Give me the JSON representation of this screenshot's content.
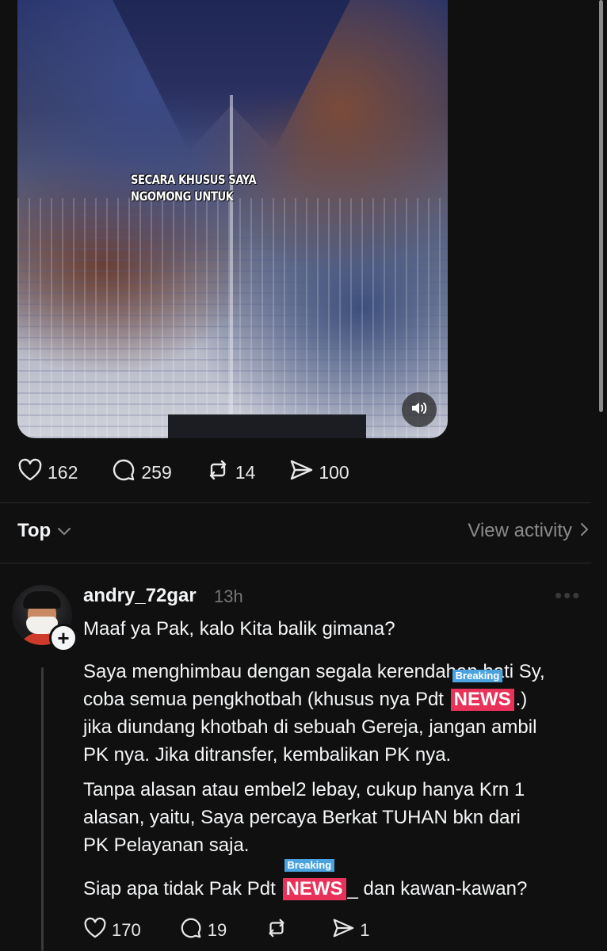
{
  "video": {
    "caption": "SECARA KHUSUS SAYA NGOMONG UNTUK",
    "sound_icon": "speaker-icon"
  },
  "post_actions": {
    "likes": "162",
    "replies": "259",
    "reposts": "14",
    "shares": "100"
  },
  "replies_bar": {
    "sort_label": "Top",
    "view_activity_label": "View activity"
  },
  "comment": {
    "username": "andry_72gar",
    "time": "13h",
    "line1": "Maaf ya Pak, kalo Kita balik gimana?",
    "p2_a": "Saya menghimbau dengan segala kerendahan hati Sy,",
    "p2_b1": "coba semua pengkhotbah (khusus nya Pdt ",
    "p2_b2": ".)",
    "p2_c": "jika diundang khotbah di sebuah Gereja, jangan ambil",
    "p2_d": "PK nya. Jika ditransfer, kembalikan PK nya.",
    "p3_a": "Tanpa alasan atau embel2 lebay, cukup hanya Krn 1",
    "p3_b": "alasan, yaitu, Saya percaya Berkat TUHAN bkn dari",
    "p3_c": "PK Pelayanan saja.",
    "p4_a": "Siap apa tidak Pak Pdt ",
    "p4_b": "_ dan kawan-kawan?",
    "badge_top": "Breaking",
    "badge_main": "NEWS",
    "likes": "170",
    "replies": "19",
    "shares": "1"
  }
}
